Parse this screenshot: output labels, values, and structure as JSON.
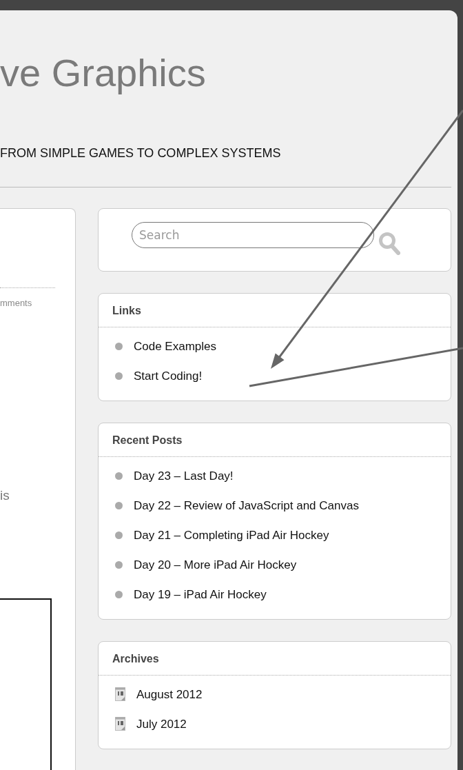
{
  "header": {
    "title": "ve Graphics",
    "tagline": "FROM SIMPLE GAMES TO COMPLEX SYSTEMS"
  },
  "post_fragment": {
    "meta": "mments",
    "text": "is"
  },
  "search": {
    "placeholder": "Search"
  },
  "widgets": [
    {
      "title": "Links",
      "kind": "bullets",
      "items": [
        "Code Examples",
        "Start Coding!"
      ]
    },
    {
      "title": "Recent Posts",
      "kind": "bullets",
      "items": [
        "Day 23 – Last Day!",
        "Day 22 – Review of JavaScript and Canvas",
        "Day 21 – Completing iPad Air Hockey",
        "Day 20 – More iPad Air Hockey",
        "Day 19 – iPad Air Hockey"
      ]
    },
    {
      "title": "Archives",
      "kind": "calendar",
      "items": [
        "August 2012",
        "July 2012"
      ]
    }
  ]
}
